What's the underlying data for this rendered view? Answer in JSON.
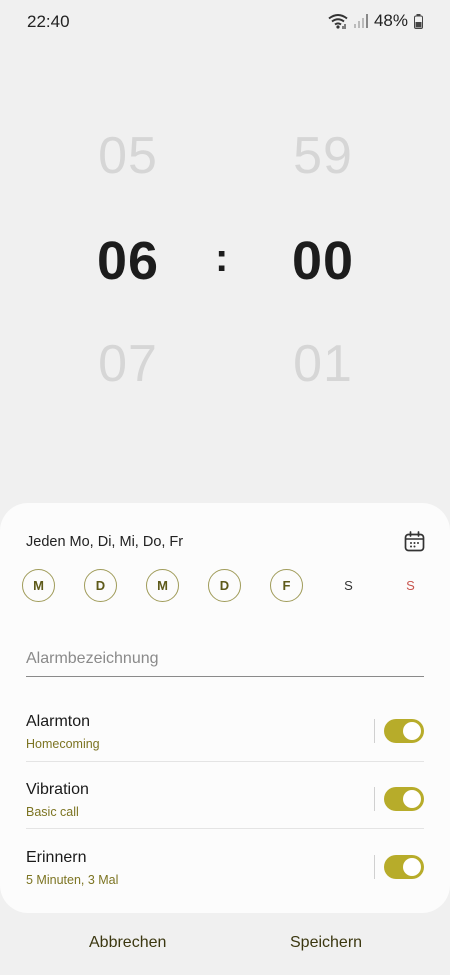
{
  "status": {
    "time": "22:40",
    "battery": "48%"
  },
  "picker": {
    "hour_prev": "05",
    "hour_current": "06",
    "hour_next": "07",
    "minute_prev": "59",
    "minute_current": "00",
    "minute_next": "01",
    "separator": ":"
  },
  "repeat": {
    "text": "Jeden Mo, Di, Mi, Do, Fr"
  },
  "days": [
    {
      "label": "M",
      "selected": true
    },
    {
      "label": "D",
      "selected": true
    },
    {
      "label": "M",
      "selected": true
    },
    {
      "label": "D",
      "selected": true
    },
    {
      "label": "F",
      "selected": true
    },
    {
      "label": "S",
      "selected": false
    },
    {
      "label": "S",
      "selected": false
    }
  ],
  "alarm_name": {
    "value": "",
    "placeholder": "Alarmbezeichnung"
  },
  "settings": {
    "alarmton": {
      "title": "Alarmton",
      "sub": "Homecoming",
      "enabled": true
    },
    "vibration": {
      "title": "Vibration",
      "sub": "Basic call",
      "enabled": true
    },
    "erinnern": {
      "title": "Erinnern",
      "sub": "5 Minuten, 3 Mal",
      "enabled": true
    }
  },
  "actions": {
    "cancel": "Abbrechen",
    "save": "Speichern"
  },
  "colors": {
    "accent": "#b7ac2a",
    "sunday": "#c8554e",
    "sheet": "#fcfcfc",
    "background": "#f0f0f0"
  }
}
